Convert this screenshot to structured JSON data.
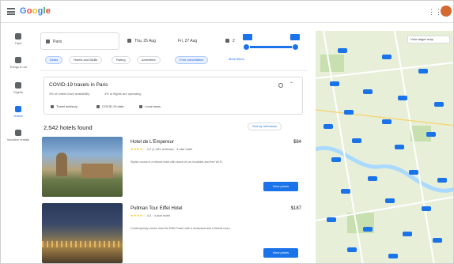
{
  "app": {
    "logo_text": "Google"
  },
  "header": {
    "menu_icon": "hamburger-menu-icon",
    "apps_icon": "apps-grid-icon",
    "avatar_color": "#d46a2f"
  },
  "rail": {
    "items": [
      {
        "icon": "flights-icon",
        "label": "Trips"
      },
      {
        "icon": "explore-icon",
        "label": "Things to do"
      },
      {
        "icon": "flights-icon",
        "label": "Flights"
      },
      {
        "icon": "hotels-icon",
        "label": "Hotels"
      },
      {
        "icon": "vacation-icon",
        "label": "Vacation rentals"
      }
    ]
  },
  "search": {
    "where": "Paris",
    "check_in": "Thu, 25 Aug",
    "check_out": "Fri, 27 Aug",
    "guests": "2"
  },
  "price_filter": {
    "min_label": "",
    "max_label": ""
  },
  "filters": {
    "chips": [
      {
        "label": "Deals",
        "selected": true
      },
      {
        "label": "Hotels and B&Bs",
        "selected": false
      },
      {
        "label": "Rating",
        "selected": false
      },
      {
        "label": "Amenities",
        "selected": false
      },
      {
        "label": "Free cancellation",
        "selected": true
      }
    ],
    "more_link": "More filters"
  },
  "covid": {
    "title": "COVID-19 travels in Paris",
    "stat_1": "3% of hotels have availability",
    "stat_2": "4% of flights are operating",
    "buttons": [
      "Travel advisory",
      "COVID-19 data",
      "Local news"
    ]
  },
  "results": {
    "count_label": "2,542 hotels found",
    "sort_label": "Sort by relevance"
  },
  "hotels": [
    {
      "name": "Hotel de L'Empereur",
      "rating_stars": "★★★★☆",
      "rating_text": "4.2 (1,284 reviews) · 3-star hotel",
      "description": "Stylish rooms in a refined hotel with views of Les Invalides and free Wi-Fi.",
      "price": "$84",
      "button": "View prices"
    },
    {
      "name": "Pullman Tour Eiffel Hotel",
      "rating_stars": "★★★★☆",
      "rating_text": "4.3 · 4-star hotel",
      "description": "Contemporary rooms near the Eiffel Tower with a restaurant and a fitness room.",
      "price": "$187",
      "button": "View prices"
    }
  ],
  "map": {
    "toggle_label": "View larger map"
  },
  "colors": {
    "accent": "#1a73e8",
    "map_land": "#e7efd9",
    "map_water": "#aadaff",
    "map_pin": "#1a73e8"
  }
}
